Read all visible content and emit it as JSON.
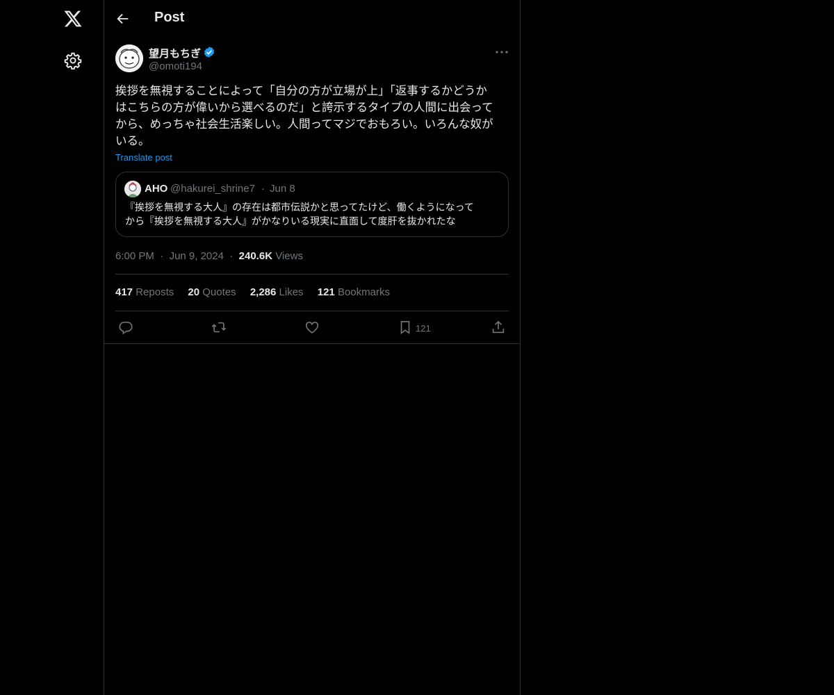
{
  "header": {
    "title": "Post"
  },
  "post": {
    "author_name": "望月もちぎ",
    "author_handle": "@omoti194",
    "text": "挨拶を無視することによって「自分の方が立場が上」「返事するかどうか\nはこちらの方が偉いから選べるのだ」と誇示するタイプの人間に出会って\nから、めっちゃ社会生活楽しい。人間ってマジでおもろい。いろんな奴が\nいる。",
    "translate_label": "Translate post",
    "time": "6:00 PM",
    "date": "Jun 9, 2024",
    "views_count": "240.6K",
    "views_label": "Views"
  },
  "quote": {
    "author_name": "AHO",
    "author_handle": "@hakurei_shrine7",
    "date": "Jun 8",
    "text": "『挨拶を無視する大人』の存在は都市伝説かと思ってたけど、働くようになって\nから『挨拶を無視する大人』がかなりいる現実に直面して度肝を抜かれたな"
  },
  "stats": {
    "reposts_count": "417",
    "reposts_label": "Reposts",
    "quotes_count": "20",
    "quotes_label": "Quotes",
    "likes_count": "2,286",
    "likes_label": "Likes",
    "bookmarks_count": "121",
    "bookmarks_label": "Bookmarks"
  },
  "actions": {
    "bookmark_count": "121"
  },
  "icons": [
    "x-logo-icon",
    "settings-icon",
    "back-arrow-icon",
    "verified-icon",
    "more-icon",
    "reply-icon",
    "repost-icon",
    "like-icon",
    "bookmark-icon",
    "share-icon"
  ],
  "colors": {
    "background": "#000000",
    "text": "#e7e9ea",
    "muted": "#71767b",
    "accent": "#1d9bf0",
    "border": "#2f3336"
  }
}
